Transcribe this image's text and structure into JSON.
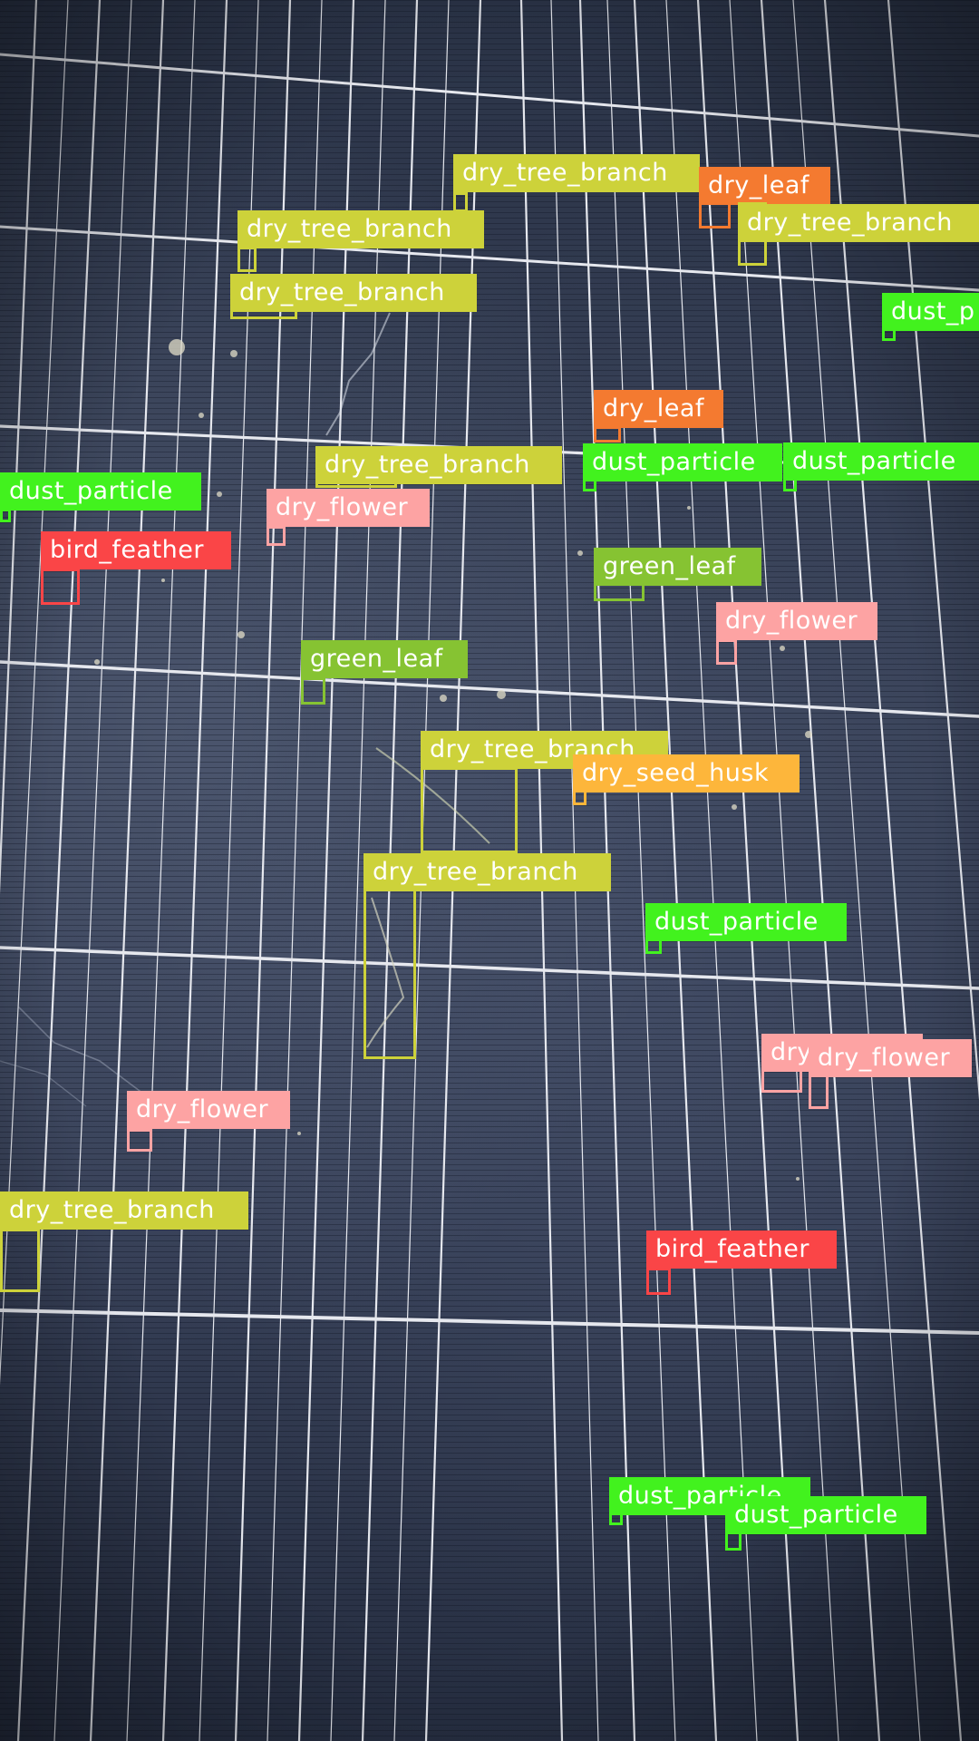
{
  "classes": {
    "dry_tree_branch": {
      "label": "dry_tree_branch",
      "color": "#cdd23a"
    },
    "dry_leaf": {
      "label": "dry_leaf",
      "color": "#f47a30"
    },
    "dust_particle": {
      "label": "dust_particle",
      "color": "#42f21e"
    },
    "dry_flower": {
      "label": "dry_flower",
      "color": "#fda3a3"
    },
    "bird_feather": {
      "label": "bird_feather",
      "color": "#fa4547"
    },
    "green_leaf": {
      "label": "green_leaf",
      "color": "#86c332"
    },
    "dry_seed_husk": {
      "label": "dry_seed_husk",
      "color": "#fdb63b"
    }
  },
  "detections": [
    {
      "cls": "dry_tree_branch",
      "text": "dry_tree_branch"
    },
    {
      "cls": "dry_leaf",
      "text": "dry_leaf"
    },
    {
      "cls": "dry_tree_branch",
      "text": "dry_tree_branch"
    },
    {
      "cls": "dry_tree_branch",
      "text": "dry_tree_branch"
    },
    {
      "cls": "dry_tree_branch",
      "text": "dry_tree_branch"
    },
    {
      "cls": "dust_particle",
      "text": "dust_p"
    },
    {
      "cls": "dry_leaf",
      "text": "dry_leaf"
    },
    {
      "cls": "dry_tree_branch",
      "text": "dry_tree_branch"
    },
    {
      "cls": "dust_particle",
      "text": "dust_particle"
    },
    {
      "cls": "dust_particle",
      "text": "dust_particle"
    },
    {
      "cls": "dust_particle",
      "text": "dust_particle"
    },
    {
      "cls": "dry_flower",
      "text": "dry_flower"
    },
    {
      "cls": "bird_feather",
      "text": "bird_feather"
    },
    {
      "cls": "green_leaf",
      "text": "green_leaf"
    },
    {
      "cls": "dry_flower",
      "text": "dry_flower"
    },
    {
      "cls": "green_leaf",
      "text": "green_leaf"
    },
    {
      "cls": "dry_tree_branch",
      "text": "dry_tree_branch"
    },
    {
      "cls": "dry_seed_husk",
      "text": "dry_seed_husk"
    },
    {
      "cls": "dry_tree_branch",
      "text": "dry_tree_branch"
    },
    {
      "cls": "dust_particle",
      "text": "dust_particle"
    },
    {
      "cls": "dry_flower",
      "text": "dry"
    },
    {
      "cls": "dry_flower",
      "text": "dry_flower"
    },
    {
      "cls": "dry_flower",
      "text": "dry_flower"
    },
    {
      "cls": "dry_tree_branch",
      "text": "dry_tree_branch"
    },
    {
      "cls": "bird_feather",
      "text": "bird_feather"
    },
    {
      "cls": "dust_particle",
      "text": "dust_particle"
    },
    {
      "cls": "dust_particle",
      "text": "dust_particle"
    }
  ]
}
